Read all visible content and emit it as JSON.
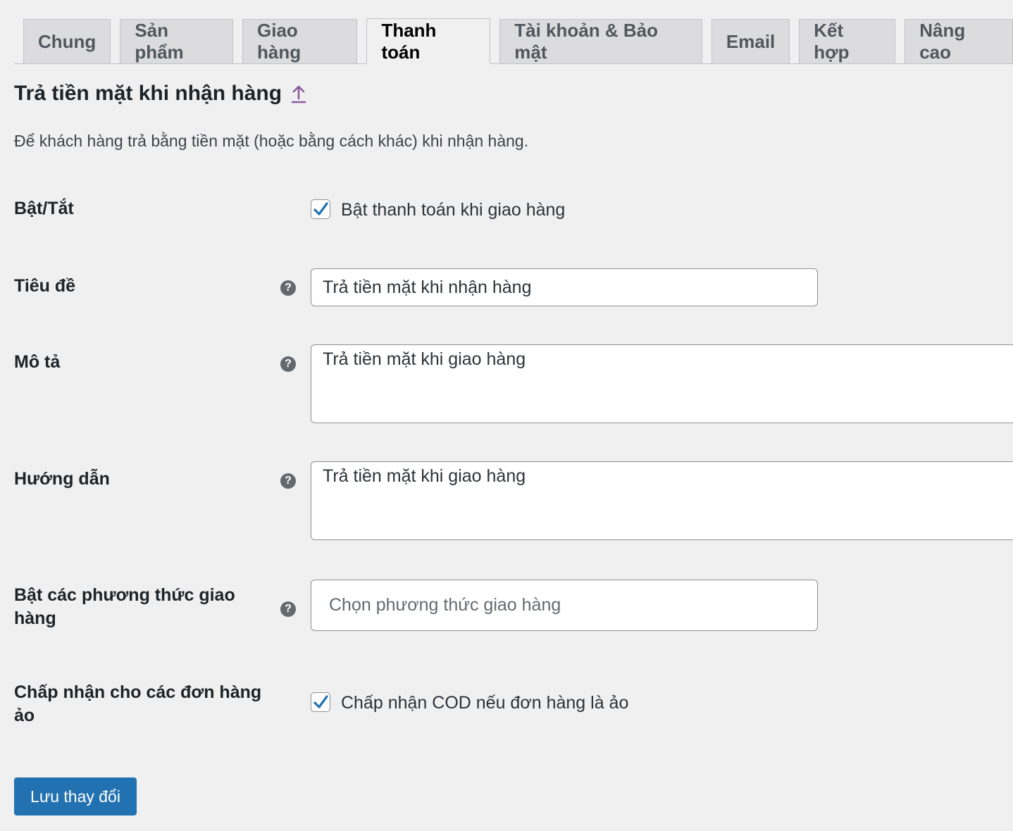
{
  "tabs": [
    {
      "label": "Chung"
    },
    {
      "label": "Sản phẩm"
    },
    {
      "label": "Giao hàng"
    },
    {
      "label": "Thanh toán"
    },
    {
      "label": "Tài khoản & Bảo mật"
    },
    {
      "label": "Email"
    },
    {
      "label": "Kết hợp"
    },
    {
      "label": "Nâng cao"
    }
  ],
  "active_tab": "Thanh toán",
  "section": {
    "title": "Trả tiền mặt khi nhận hàng",
    "description": "Để khách hàng trả bằng tiền mặt (hoặc bằng cách khác) khi nhận hàng."
  },
  "fields": {
    "enable": {
      "label": "Bật/Tắt",
      "checkbox_label": "Bật thanh toán khi giao hàng",
      "checked": true
    },
    "title": {
      "label": "Tiêu đề",
      "value": "Trả tiền mặt khi nhận hàng"
    },
    "description": {
      "label": "Mô tả",
      "value": "Trả tiền mặt khi giao hàng"
    },
    "instructions": {
      "label": "Hướng dẫn",
      "value": "Trả tiền mặt khi giao hàng"
    },
    "shipping_methods": {
      "label": "Bật các phương thức giao hàng",
      "placeholder": "Chọn phương thức giao hàng"
    },
    "virtual_orders": {
      "label": "Chấp nhận cho các đơn hàng ảo",
      "checkbox_label": "Chấp nhận COD nếu đơn hàng là ảo",
      "checked": true
    }
  },
  "help_icon_glyph": "?",
  "save_button": {
    "label": "Lưu thay đổi"
  },
  "colors": {
    "accent": "#2271b1",
    "background": "#f0f0f1",
    "link": "#8c5a9c"
  }
}
